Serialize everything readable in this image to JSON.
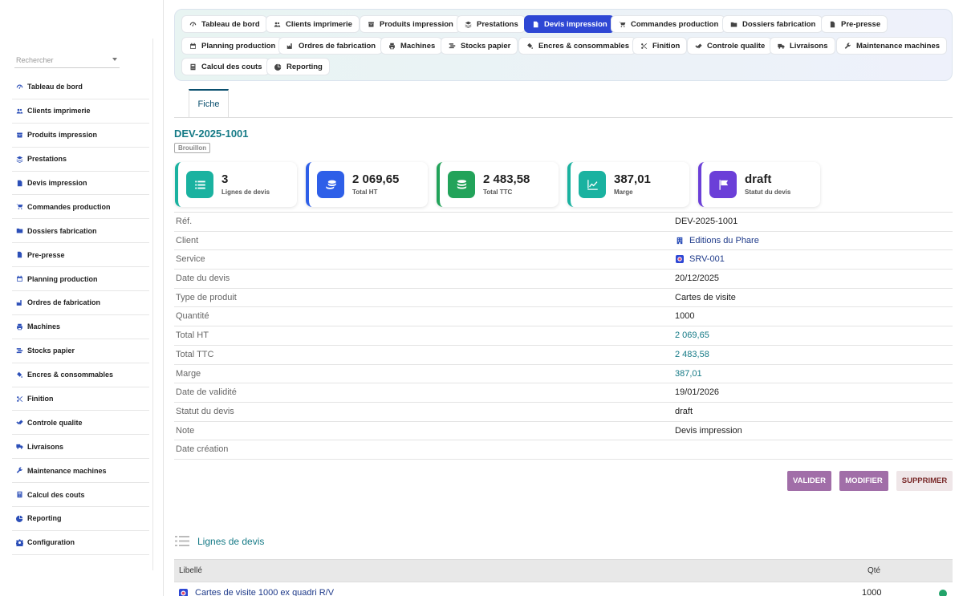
{
  "sidebar": {
    "search_placeholder": "Rechercher",
    "items": [
      {
        "label": "Tableau de bord",
        "icon": "gauge-icon"
      },
      {
        "label": "Clients imprimerie",
        "icon": "users-icon"
      },
      {
        "label": "Produits impression",
        "icon": "box-icon"
      },
      {
        "label": "Prestations",
        "icon": "layers-icon"
      },
      {
        "label": "Devis impression",
        "icon": "file-icon"
      },
      {
        "label": "Commandes production",
        "icon": "cart-icon"
      },
      {
        "label": "Dossiers fabrication",
        "icon": "folder-icon"
      },
      {
        "label": "Pre-presse",
        "icon": "file-alt-icon"
      },
      {
        "label": "Planning production",
        "icon": "calendar-icon"
      },
      {
        "label": "Ordres de fabrication",
        "icon": "factory-icon"
      },
      {
        "label": "Machines",
        "icon": "printer-icon"
      },
      {
        "label": "Stocks papier",
        "icon": "stock-icon"
      },
      {
        "label": "Encres & consommables",
        "icon": "fill-icon"
      },
      {
        "label": "Finition",
        "icon": "scissors-icon"
      },
      {
        "label": "Controle qualite",
        "icon": "check-double-icon"
      },
      {
        "label": "Livraisons",
        "icon": "truck-icon"
      },
      {
        "label": "Maintenance machines",
        "icon": "wrench-icon"
      },
      {
        "label": "Calcul des couts",
        "icon": "calculator-icon"
      },
      {
        "label": "Reporting",
        "icon": "pie-icon"
      },
      {
        "label": "Configuration",
        "icon": "gear-icon"
      }
    ]
  },
  "topnav": {
    "tabs": [
      {
        "label": "Tableau de bord",
        "icon": "gauge-icon"
      },
      {
        "label": "Clients imprimerie",
        "icon": "users-icon"
      },
      {
        "label": "Produits impression",
        "icon": "box-icon"
      },
      {
        "label": "Prestations",
        "icon": "layers-icon"
      },
      {
        "label": "Devis impression",
        "icon": "file-icon",
        "active": true
      },
      {
        "label": "Commandes production",
        "icon": "cart-icon"
      },
      {
        "label": "Dossiers fabrication",
        "icon": "folder-icon"
      },
      {
        "label": "Pre-presse",
        "icon": "file-alt-icon"
      },
      {
        "label": "Planning production",
        "icon": "calendar-icon"
      },
      {
        "label": "Ordres de fabrication",
        "icon": "factory-icon"
      },
      {
        "label": "Machines",
        "icon": "printer-icon"
      },
      {
        "label": "Stocks papier",
        "icon": "stock-icon"
      },
      {
        "label": "Encres & consommables",
        "icon": "fill-icon"
      },
      {
        "label": "Finition",
        "icon": "scissors-icon"
      },
      {
        "label": "Controle qualite",
        "icon": "check-double-icon"
      },
      {
        "label": "Livraisons",
        "icon": "truck-icon"
      },
      {
        "label": "Maintenance machines",
        "icon": "wrench-icon"
      },
      {
        "label": "Calcul des couts",
        "icon": "calculator-icon"
      },
      {
        "label": "Reporting",
        "icon": "pie-icon"
      }
    ]
  },
  "record": {
    "tab_label": "Fiche",
    "title": "DEV-2025-1001",
    "status_badge": "Brouillon"
  },
  "stats": [
    {
      "value": "3",
      "label": "Lignes de devis",
      "color": "#1ab2a0",
      "icon": "list-icon"
    },
    {
      "value": "2 069,65",
      "label": "Total HT",
      "color": "#2e5fe8",
      "icon": "coins-icon"
    },
    {
      "value": "2 483,58",
      "label": "Total TTC",
      "color": "#22a35a",
      "icon": "money-icon"
    },
    {
      "value": "387,01",
      "label": "Marge",
      "color": "#1ab2a0",
      "icon": "chart-line-icon"
    },
    {
      "value": "draft",
      "label": "Statut du devis",
      "color": "#6b3fd8",
      "icon": "flag-icon"
    }
  ],
  "fields": [
    {
      "label": "Réf.",
      "value": "DEV-2025-1001",
      "kind": "text"
    },
    {
      "label": "Client",
      "value": "Editions du Phare",
      "kind": "link",
      "icon": "building-icon"
    },
    {
      "label": "Service",
      "value": "SRV-001",
      "kind": "link",
      "icon": "service-icon"
    },
    {
      "label": "Date du devis",
      "value": "20/12/2025",
      "kind": "text"
    },
    {
      "label": "Type de produit",
      "value": "Cartes de visite",
      "kind": "text"
    },
    {
      "label": "Quantité",
      "value": "1000",
      "kind": "text"
    },
    {
      "label": "Total HT",
      "value": "2 069,65",
      "kind": "money"
    },
    {
      "label": "Total TTC",
      "value": "2 483,58",
      "kind": "money"
    },
    {
      "label": "Marge",
      "value": "387,01",
      "kind": "money"
    },
    {
      "label": "Date de validité",
      "value": "19/01/2026",
      "kind": "text"
    },
    {
      "label": "Statut du devis",
      "value": "draft",
      "kind": "text"
    },
    {
      "label": "Note",
      "value": "Devis impression",
      "kind": "text"
    },
    {
      "label": "Date création",
      "value": "",
      "kind": "text"
    }
  ],
  "actions": {
    "validate": "VALIDER",
    "modify": "MODIFIER",
    "delete": "SUPPRIMER"
  },
  "lines": {
    "title": "Lignes de devis",
    "col_label": "Libellé",
    "col_qty": "Qté",
    "rows": [
      {
        "label": "Cartes de visite 1000 ex quadri R/V",
        "qty": "1000",
        "status_color": "#23a46a"
      }
    ]
  }
}
